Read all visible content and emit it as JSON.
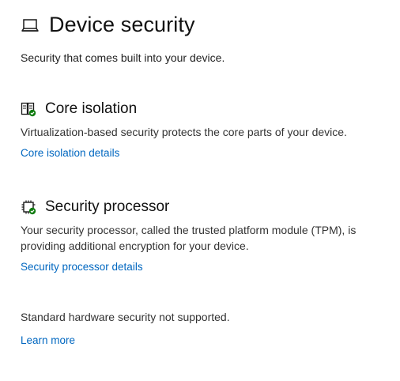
{
  "header": {
    "title": "Device security",
    "icon": "laptop-icon",
    "subtitle": "Security that comes built into your device."
  },
  "core_isolation": {
    "icon": "core-isolation-icon",
    "title": "Core isolation",
    "description": "Virtualization-based security protects the core parts of your device.",
    "link": "Core isolation details"
  },
  "security_processor": {
    "icon": "chip-icon",
    "title": "Security processor",
    "description": "Your security processor, called the trusted platform module (TPM), is providing additional encryption for your device.",
    "link": "Security processor details"
  },
  "hardware_note": {
    "text": "Standard hardware security not supported.",
    "link": "Learn more"
  },
  "colors": {
    "link": "#0067c0",
    "status_ok": "#107c10"
  }
}
